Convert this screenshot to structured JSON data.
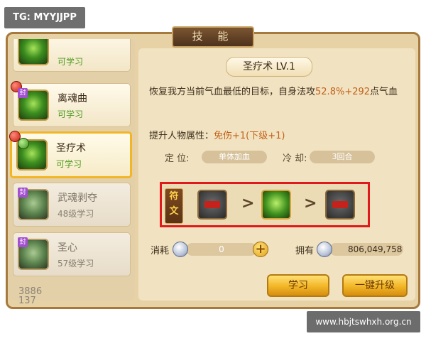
{
  "watermark_tag": "TG: MYYJJPP",
  "footer_url": "www.hbjtswhxh.org.cn",
  "window_title": "技 能",
  "skills": [
    {
      "name": "",
      "status": "可学习",
      "badge": "",
      "dot": ""
    },
    {
      "name": "离魂曲",
      "status": "可学习",
      "badge": "封",
      "dot": "red"
    },
    {
      "name": "圣疗术",
      "status": "可学习",
      "badge": "",
      "dot": "red-green"
    },
    {
      "name": "武魂剥夺",
      "status": "48级学习",
      "badge": "封",
      "dot": ""
    },
    {
      "name": "圣心",
      "status": "57级学习",
      "badge": "封",
      "dot": ""
    }
  ],
  "left_bottom_numbers": [
    "3886",
    "137"
  ],
  "detail": {
    "title": "圣疗术 LV.1",
    "description_prefix": "恢复我方当前气血最低的目标，自身法攻",
    "description_highlight": "52.8%+292",
    "description_suffix": "点气血",
    "attr_label": "提升人物属性：",
    "attr_value": "免伤+1(下级+1)",
    "position_label": "定 位:",
    "position_value": "单体加血",
    "cooldown_label": "冷 却:",
    "cooldown_value": "3回合"
  },
  "rune": {
    "tag_line1": "符",
    "tag_line2": "文",
    "arrow": ">"
  },
  "cost": {
    "label": "消耗",
    "value": "0",
    "plus": "+",
    "own_label": "拥有",
    "own_value": "806,049,758"
  },
  "buttons": {
    "learn": "学习",
    "upgrade": "一键升级"
  },
  "colors": {
    "highlight": "#c2601a",
    "status_green": "#4d9a20",
    "button_gold": "#f2b526",
    "rune_box_border": "#e0191a"
  }
}
